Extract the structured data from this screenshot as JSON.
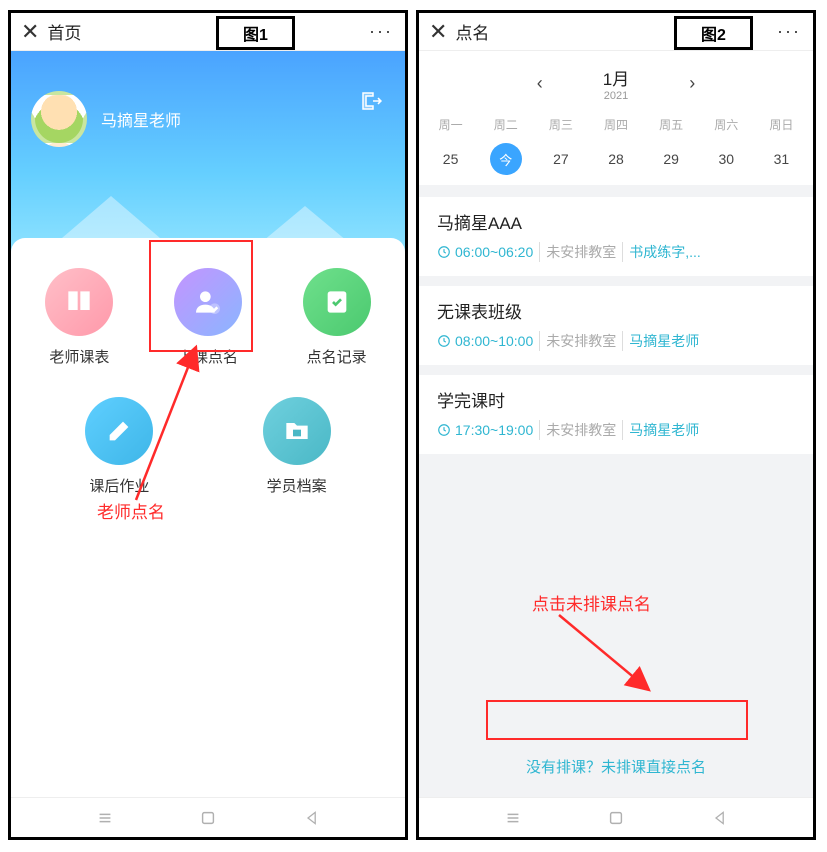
{
  "label1": "图1",
  "label2": "图2",
  "left": {
    "titlebar": {
      "close": "✕",
      "title": "首页",
      "dots": "···"
    },
    "user": {
      "name": "马摘星老师"
    },
    "menu": [
      {
        "label": "老师课表"
      },
      {
        "label": "上课点名"
      },
      {
        "label": "点名记录"
      },
      {
        "label": "课后作业"
      },
      {
        "label": "学员档案"
      }
    ],
    "annotation": "老师点名"
  },
  "right": {
    "titlebar": {
      "close": "✕",
      "title": "点名",
      "dots": "···"
    },
    "calendar": {
      "month": "1月",
      "year": "2021",
      "weekdays": [
        "周一",
        "周二",
        "周三",
        "周四",
        "周五",
        "周六",
        "周日"
      ],
      "dates": [
        "25",
        "今",
        "27",
        "28",
        "29",
        "30",
        "31"
      ],
      "today_index": 1
    },
    "classes": [
      {
        "title": "马摘星AAA",
        "time": "06:00~06:20",
        "room": "未安排教室",
        "link": "书成练字,..."
      },
      {
        "title": "无课表班级",
        "time": "08:00~10:00",
        "room": "未安排教室",
        "link": "马摘星老师"
      },
      {
        "title": "学完课时",
        "time": "17:30~19:00",
        "room": "未安排教室",
        "link": "马摘星老师"
      }
    ],
    "annotation": "点击未排课点名",
    "bottomlink": "没有排课？未排课直接点名"
  }
}
